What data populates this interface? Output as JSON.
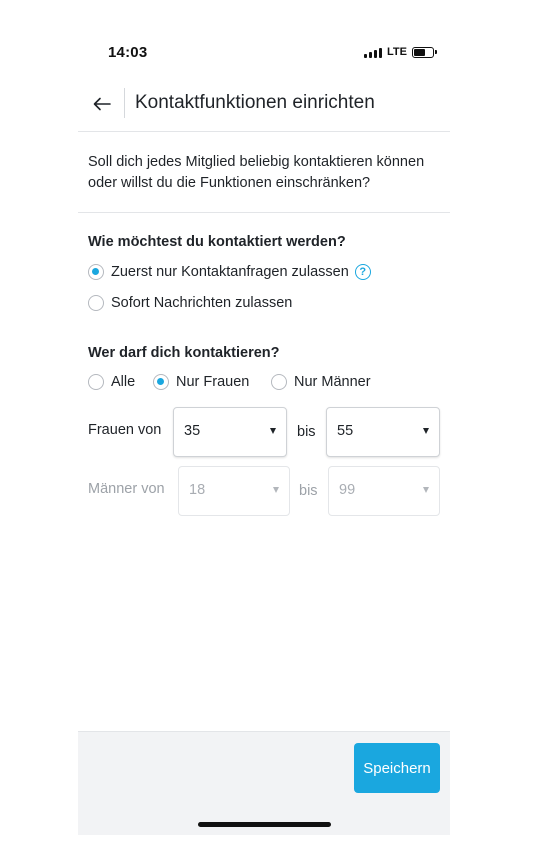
{
  "status_bar": {
    "time": "14:03",
    "network": "LTE"
  },
  "header": {
    "back_icon": "arrow-left-icon",
    "title": "Kontaktfunktionen einrichten"
  },
  "intro": {
    "text": "Soll dich jedes Mitglied beliebig kontaktieren können oder willst du die Funktionen einschränken?"
  },
  "contact_mode": {
    "heading": "Wie möchtest du kontaktiert werden?",
    "options": [
      {
        "label": "Zuerst nur Kontaktanfragen zulassen",
        "selected": true
      },
      {
        "label": "Sofort Nachrichten zulassen",
        "selected": false
      }
    ],
    "help_icon": "question-circle-icon",
    "help_glyph": "?"
  },
  "who_can_contact": {
    "heading": "Wer darf dich kontaktieren?",
    "options": [
      {
        "label": "Alle",
        "selected": false
      },
      {
        "label": "Nur Frauen",
        "selected": true
      },
      {
        "label": "Nur Männer",
        "selected": false
      }
    ]
  },
  "women_range": {
    "label": "Frauen von",
    "from": "35",
    "separator": "bis",
    "to": "55",
    "enabled": true
  },
  "men_range": {
    "label": "Männer von",
    "from": "18",
    "separator": "bis",
    "to": "99",
    "enabled": false
  },
  "footer": {
    "save_label": "Speichern"
  },
  "colors": {
    "accent": "#1aa7df",
    "text": "#1f2328",
    "disabled_text": "#9da2a8",
    "footer_bg": "#f2f3f5"
  }
}
